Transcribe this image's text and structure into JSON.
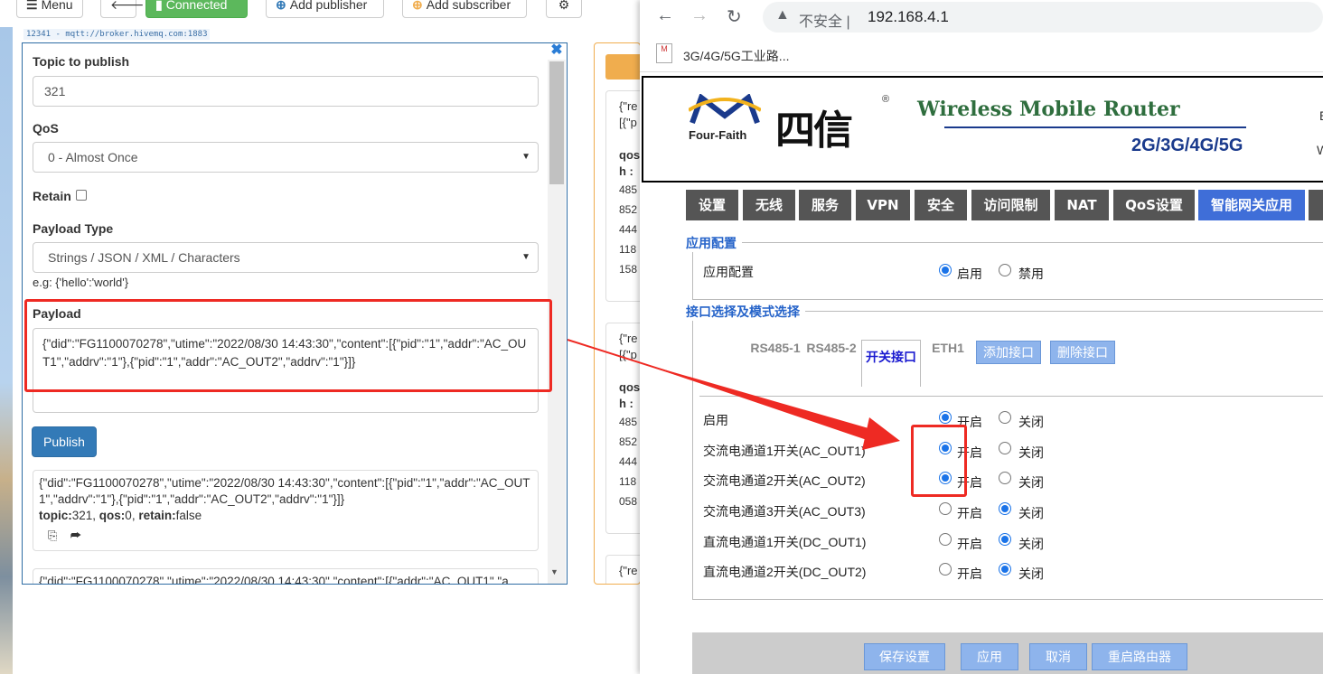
{
  "mqtt": {
    "toolbar": {
      "menu_label": "Menu",
      "connected_label": "Connected",
      "add_publisher_label": "Add publisher",
      "add_subscriber_label": "Add subscriber"
    },
    "broker": "12341 - mqtt://broker.hivemq.com:1883",
    "publish": {
      "close_glyph": "✖",
      "topic_label": "Topic to publish",
      "topic_value": "321",
      "qos_label": "QoS",
      "qos_value": "0 - Almost Once",
      "retain_label": "Retain",
      "payload_type_label": "Payload Type",
      "payload_type_value": "Strings / JSON / XML / Characters",
      "payload_hint": "e.g: {'hello':'world'}",
      "payload_label": "Payload",
      "payload_value": "{\"did\":\"FG1100070278\",\"utime\":\"2022/08/30 14:43:30\",\"content\":[{\"pid\":\"1\",\"addr\":\"AC_OUT1\",\"addrv\":\"1\"},{\"pid\":\"1\",\"addr\":\"AC_OUT2\",\"addrv\":\"1\"}]}",
      "publish_button": "Publish"
    },
    "messages": [
      {
        "text": "{\"did\":\"FG1100070278\",\"utime\":\"2022/08/30 14:43:30\",\"content\":[{\"pid\":\"1\",\"addr\":\"AC_OUT1\",\"addrv\":\"1\"},{\"pid\":\"1\",\"addr\":\"AC_OUT2\",\"addrv\":\"1\"}]}",
        "topic_key": "topic:",
        "topic": "321",
        "qos_key": "qos:",
        "qos": "0",
        "retain_key": "retain:",
        "retain": "false"
      },
      {
        "text": "{\"did\":\"FG1100070278\",\"utime\":\"2022/08/30 14:43:30\",\"content\":[{\"addr\":\"AC_OUT1\",\"a"
      }
    ],
    "subscriber_cards": [
      {
        "l1": "{\"re",
        "l2": "[{\"p",
        "l3": "qos",
        "l4": "h :",
        "l5": "485",
        "l6": "852",
        "l7": "444",
        "l8": "118",
        "l9": "158"
      },
      {
        "l1": "{\"re",
        "l2": "[{\"p",
        "l3": "qos",
        "l4": "h :",
        "l5": "485",
        "l6": "852",
        "l7": "444",
        "l8": "118",
        "l9": "058"
      },
      {
        "l1": "{\"re"
      }
    ]
  },
  "browser": {
    "insecure_label": "不安全",
    "url": "192.168.4.1",
    "bookmark_title": "3G/4G/5G工业路...",
    "bookmark_icon_text": "M"
  },
  "router": {
    "logo_brand_en": "Four-Faith",
    "logo_brand_cn": "四信",
    "registered": "®",
    "product_title": "Wireless Mobile Router",
    "generations": "2G/3G/4G/5G",
    "header_right_1": "E",
    "header_right_2": "W",
    "tabs": [
      "设置",
      "无线",
      "服务",
      "VPN",
      "安全",
      "访问限制",
      "NAT",
      "QoS设置",
      "智能网关应用"
    ],
    "app_section": {
      "legend": "应用配置",
      "row_label": "应用配置",
      "opt_on": "启用",
      "opt_off": "禁用"
    },
    "iface_section": {
      "legend": "接口选择及模式选择",
      "tabs": [
        "RS485-1",
        "RS485-2",
        "开关接口",
        "ETH1"
      ],
      "add_button": "添加接口",
      "del_button": "删除接口"
    },
    "switch_rows": [
      {
        "label": "启用",
        "on": "开启",
        "off": "关闭",
        "value": "on"
      },
      {
        "label": "交流电通道1开关(AC_OUT1)",
        "on": "开启",
        "off": "关闭",
        "value": "on"
      },
      {
        "label": "交流电通道2开关(AC_OUT2)",
        "on": "开启",
        "off": "关闭",
        "value": "on"
      },
      {
        "label": "交流电通道3开关(AC_OUT3)",
        "on": "开启",
        "off": "关闭",
        "value": "off"
      },
      {
        "label": "直流电通道1开关(DC_OUT1)",
        "on": "开启",
        "off": "关闭",
        "value": "off"
      },
      {
        "label": "直流电通道2开关(DC_OUT2)",
        "on": "开启",
        "off": "关闭",
        "value": "off"
      }
    ],
    "footer_buttons": [
      "保存设置",
      "应用",
      "取消",
      "重启路由器"
    ]
  },
  "colors": {
    "highlight_red": "#ee2a23",
    "mqtt_primary": "#337ab7",
    "connected_green": "#5cb85c",
    "router_tab_active": "#3f6ed8",
    "router_button": "#8eb4ec"
  }
}
